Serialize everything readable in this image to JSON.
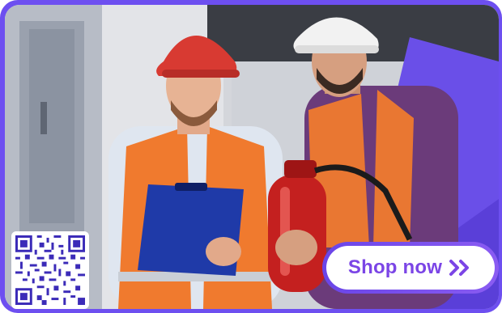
{
  "cta": {
    "label": "Shop now",
    "icon": "double-chevron-right-icon"
  },
  "qr": {
    "icon": "qr-code-icon"
  },
  "colors": {
    "accent": "#6d4ff0",
    "button_text": "#7b45e6",
    "vest": "#f07a2e",
    "helmet_red": "#d83a32",
    "helmet_white": "#f2f2f2",
    "clipboard": "#1f3aa8"
  }
}
